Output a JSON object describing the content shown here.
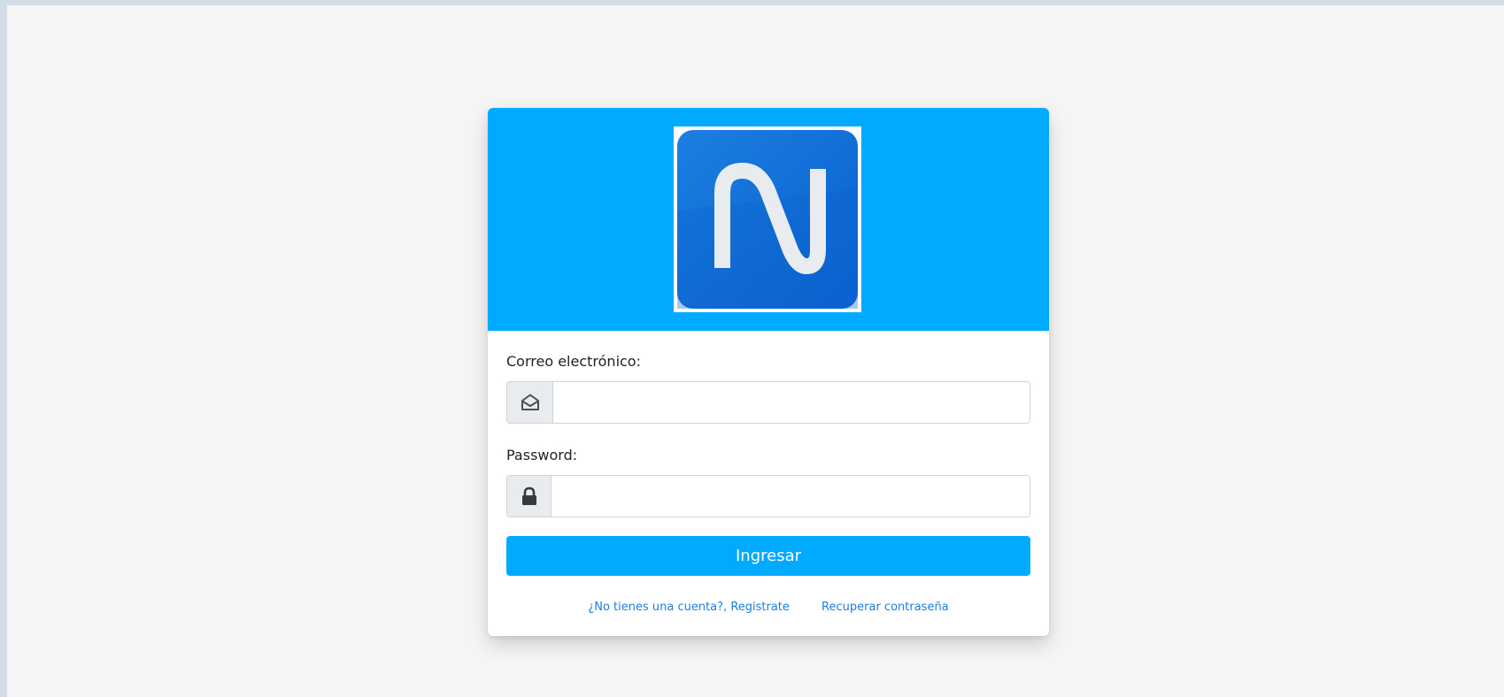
{
  "logo": {
    "icon": "n-logo-icon",
    "background": "#0a6fd8",
    "letter_color": "#e8ecef"
  },
  "header": {
    "background": "#00aaff"
  },
  "form": {
    "email_label": "Correo electrónico:",
    "email_icon": "envelope-open-icon",
    "email_value": "",
    "password_label": "Password:",
    "password_icon": "lock-icon",
    "password_value": "",
    "submit_label": "Ingresar"
  },
  "links": {
    "register": "¿No tienes una cuenta?, Registrate",
    "recover": "Recuperar contraseña",
    "color": "#1a7ee6"
  }
}
